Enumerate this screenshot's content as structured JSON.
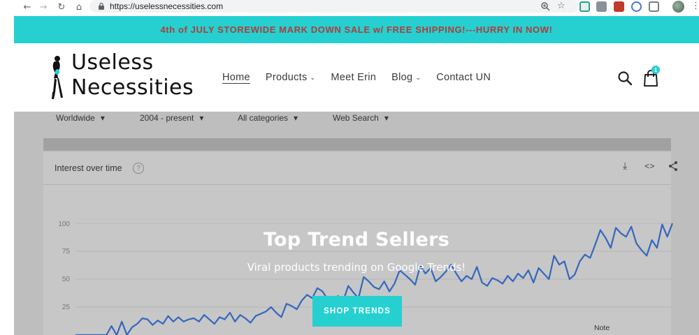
{
  "browser": {
    "url": "https://uselessnecessities.com"
  },
  "announcement": {
    "text": "4th of JULY STOREWIDE MARK DOWN SALE w/ FREE SHIPPING!---HURRY IN NOW!"
  },
  "header": {
    "logo_line1": "Useless",
    "logo_line2": "Necessities",
    "nav": [
      {
        "label": "Home",
        "active": true,
        "dropdown": false
      },
      {
        "label": "Products",
        "active": false,
        "dropdown": true
      },
      {
        "label": "Meet Erin",
        "active": false,
        "dropdown": false
      },
      {
        "label": "Blog",
        "active": false,
        "dropdown": true
      },
      {
        "label": "Contact UN",
        "active": false,
        "dropdown": false
      }
    ],
    "cart_count": "1"
  },
  "hero": {
    "title": "Top Trend Sellers",
    "subtitle": "Viral products trending on Google Trends!",
    "cta_label": "SHOP TRENDS",
    "background": {
      "filters": [
        "Worldwide",
        "2004 - present",
        "All categories",
        "Web Search"
      ],
      "card_title": "Interest over time",
      "y_ticks": [
        "100",
        "75",
        "50",
        "25"
      ],
      "note": "Note",
      "trend_series": [
        0,
        0,
        0,
        0,
        0,
        0,
        0,
        8,
        0,
        12,
        0,
        7,
        10,
        15,
        14,
        9,
        13,
        10,
        17,
        12,
        16,
        12,
        14,
        15,
        12,
        18,
        14,
        10,
        16,
        14,
        20,
        12,
        18,
        15,
        11,
        17,
        19,
        21,
        25,
        20,
        16,
        28,
        26,
        23,
        31,
        36,
        33,
        42,
        39,
        32,
        27,
        35,
        30,
        44,
        38,
        33,
        52,
        48,
        43,
        41,
        48,
        39,
        46,
        58,
        54,
        50,
        45,
        62,
        55,
        60,
        48,
        52,
        57,
        63,
        55,
        48,
        53,
        50,
        61,
        47,
        44,
        51,
        49,
        46,
        53,
        48,
        55,
        51,
        58,
        47,
        60,
        55,
        50,
        71,
        63,
        66,
        50,
        54,
        66,
        72,
        69,
        81,
        94,
        87,
        78,
        96,
        91,
        88,
        97,
        82,
        76,
        71,
        85,
        78,
        99,
        88,
        100
      ]
    }
  },
  "colors": {
    "accent": "#26d0d0",
    "announcement_text": "#b33a3a",
    "trend_line": "#4285f4"
  }
}
